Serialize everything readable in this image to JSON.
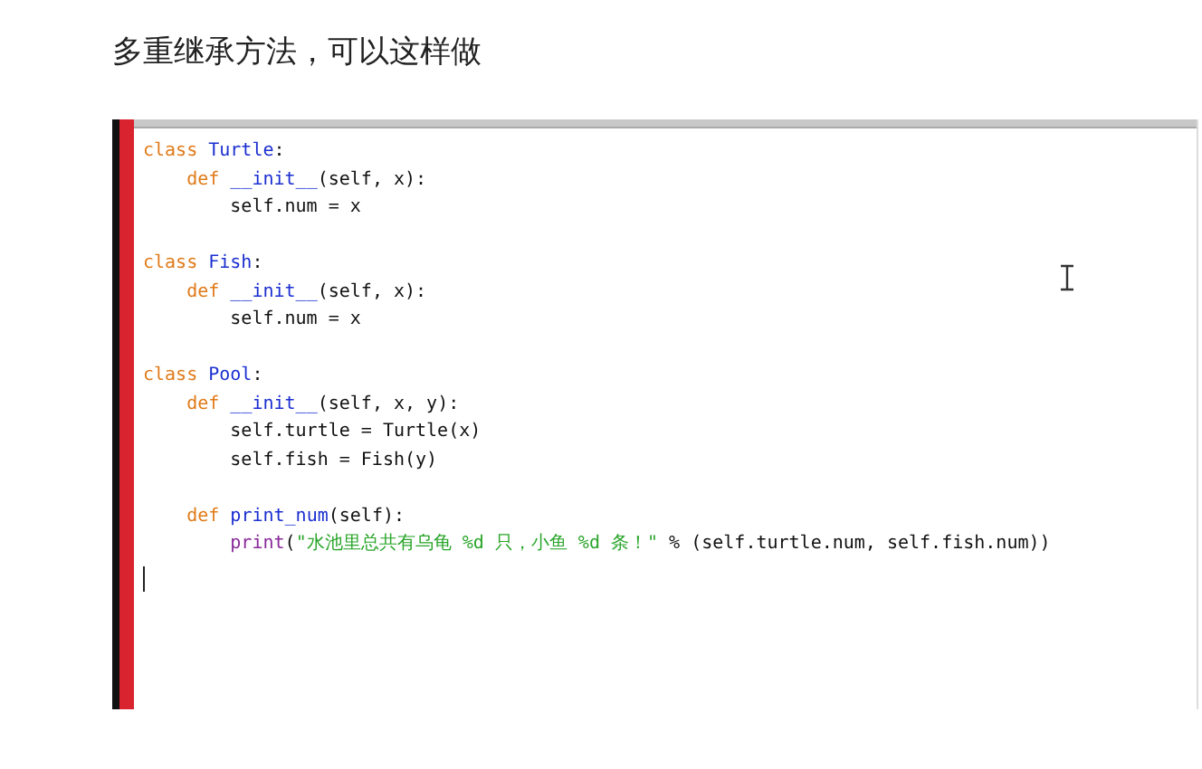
{
  "heading": "多重继承方法，可以这样做",
  "code_lines": [
    {
      "kind": "code",
      "tokens": [
        {
          "kind": "keyword",
          "text": "class "
        },
        {
          "kind": "name",
          "text": "Turtle"
        },
        {
          "kind": "plain",
          "text": ":"
        }
      ]
    },
    {
      "kind": "code",
      "tokens": [
        {
          "kind": "keyword",
          "text": "    def "
        },
        {
          "kind": "name",
          "text": "__init__"
        },
        {
          "kind": "plain",
          "text": "(self, x):"
        }
      ]
    },
    {
      "kind": "code",
      "tokens": [
        {
          "kind": "plain",
          "text": "        self.num = x"
        }
      ]
    },
    {
      "kind": "blank"
    },
    {
      "kind": "code",
      "tokens": [
        {
          "kind": "keyword",
          "text": "class "
        },
        {
          "kind": "name",
          "text": "Fish"
        },
        {
          "kind": "plain",
          "text": ":"
        }
      ]
    },
    {
      "kind": "code",
      "tokens": [
        {
          "kind": "keyword",
          "text": "    def "
        },
        {
          "kind": "name",
          "text": "__init__"
        },
        {
          "kind": "plain",
          "text": "(self, x):"
        }
      ]
    },
    {
      "kind": "code",
      "tokens": [
        {
          "kind": "plain",
          "text": "        self.num = x"
        }
      ]
    },
    {
      "kind": "blank"
    },
    {
      "kind": "code",
      "tokens": [
        {
          "kind": "keyword",
          "text": "class "
        },
        {
          "kind": "name",
          "text": "Pool"
        },
        {
          "kind": "plain",
          "text": ":"
        }
      ]
    },
    {
      "kind": "code",
      "tokens": [
        {
          "kind": "keyword",
          "text": "    def "
        },
        {
          "kind": "name",
          "text": "__init__"
        },
        {
          "kind": "plain",
          "text": "(self, x, y):"
        }
      ]
    },
    {
      "kind": "code",
      "tokens": [
        {
          "kind": "plain",
          "text": "        self.turtle = Turtle(x)"
        }
      ]
    },
    {
      "kind": "code",
      "tokens": [
        {
          "kind": "plain",
          "text": "        self.fish = Fish(y)"
        }
      ]
    },
    {
      "kind": "blank"
    },
    {
      "kind": "code",
      "tokens": [
        {
          "kind": "keyword",
          "text": "    def "
        },
        {
          "kind": "name",
          "text": "print_num"
        },
        {
          "kind": "plain",
          "text": "(self):"
        }
      ]
    },
    {
      "kind": "code",
      "tokens": [
        {
          "kind": "builtin",
          "text": "        print"
        },
        {
          "kind": "plain",
          "text": "("
        },
        {
          "kind": "string",
          "text": "\"水池里总共有乌龟 %d 只，小鱼 %d 条！\""
        },
        {
          "kind": "plain",
          "text": " % (self.turtle.num, self.fish.num))"
        }
      ]
    }
  ]
}
